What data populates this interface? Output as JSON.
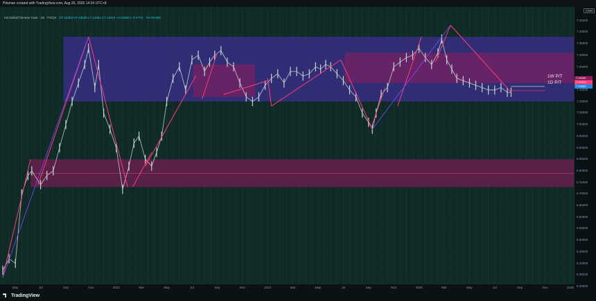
{
  "header": {
    "published_by": "Pituman created with TradingView.com, Aug 26, 2025 14:24 UTC+8"
  },
  "legend": {
    "symbol": "US Dollar/Chinese Yuan · 1D · FXCM",
    "ohlc": "O7.16383 H7.16535 L7.14361 C7.14424 −0.01959 (−0.27%)",
    "volume": "Vol 82.55K"
  },
  "price_axis": {
    "currency": "CNH",
    "last_price": "7.16040",
    "tag_2": "7.14424",
    "tag_3": "7.13550"
  },
  "annotations": {
    "weekly_pt": "1W P/T",
    "daily_pt": "1D P/T"
  },
  "footer": {
    "brand": "TradingView"
  },
  "colors": {
    "background": "#0f2a27",
    "purple_zone": "#3e2f8f",
    "pink_zone": "#8b1d5e",
    "projection": "#ff3b7a",
    "down_leg": "#7a4dff",
    "candles": "#c7d6d2"
  },
  "chart_data": {
    "type": "line",
    "title": "",
    "xlabel": "",
    "ylabel": "",
    "ylim": [
      6.3,
      7.5
    ],
    "y_ticks": [
      "7.45000",
      "7.40000",
      "7.35000",
      "7.30000",
      "7.25000",
      "7.20000",
      "7.15000",
      "7.10000",
      "7.05000",
      "7.00000",
      "6.95000",
      "6.90000",
      "6.85000",
      "6.80000",
      "6.75000",
      "6.70000",
      "6.65000",
      "6.60000",
      "6.55000",
      "6.50000",
      "6.45000",
      "6.40000",
      "6.35000",
      "6.30000"
    ],
    "x_labels": [
      "May",
      "Jul",
      "Sep",
      "Nov",
      "2023",
      "Mar",
      "May",
      "Jul",
      "Sep",
      "Nov",
      "2024",
      "Mar",
      "May",
      "Jul",
      "Sep",
      "Nov",
      "2025",
      "Mar",
      "May",
      "Jul",
      "Sep",
      "Nov",
      "2026"
    ],
    "x_label_months": [
      4.0,
      6.0,
      8.0,
      10.0,
      12.0,
      14.0,
      16.0,
      18.0,
      20.0,
      22.0,
      24.0,
      26.0,
      28.0,
      30.0,
      32.0,
      34.0,
      36.0,
      38.0,
      40.0,
      42.0,
      44.0,
      46.0,
      48.0
    ],
    "series": [
      {
        "values_x_months": [
          3.0,
          3.5,
          4.0,
          4.5,
          5.0,
          5.3,
          6.0,
          6.5,
          7.0,
          7.5,
          8.0,
          8.5,
          9.0,
          9.5,
          9.8,
          10.3,
          10.6,
          11.0,
          11.5,
          12.0,
          12.5,
          13.0,
          13.4,
          13.8,
          14.3,
          14.8,
          15.2,
          15.6,
          16.0,
          16.5,
          17.0,
          17.5,
          18.0,
          18.5,
          19.0,
          19.4,
          19.8,
          20.3,
          20.8,
          21.3,
          21.8,
          22.3,
          22.8,
          23.3,
          23.8,
          24.3,
          24.8,
          25.3,
          25.8,
          26.3,
          26.8,
          27.3,
          27.8,
          28.2,
          28.6,
          29.0,
          29.5,
          30.0,
          30.5,
          31.0,
          31.5,
          32.0,
          32.3,
          32.6,
          33.0,
          33.5,
          34.0,
          34.5,
          35.0,
          35.5,
          36.0,
          36.5,
          37.0,
          37.5,
          37.8,
          38.2,
          38.6,
          39.0,
          39.5,
          40.0,
          40.5,
          41.0,
          41.5,
          42.0,
          42.5,
          43.0,
          43.3
        ],
        "values": [
          6.37,
          6.42,
          6.4,
          6.7,
          6.78,
          6.8,
          6.74,
          6.78,
          6.8,
          6.9,
          7.0,
          7.1,
          7.18,
          7.26,
          7.33,
          7.16,
          7.26,
          7.05,
          6.98,
          6.9,
          6.72,
          6.82,
          6.92,
          6.95,
          6.85,
          6.82,
          6.88,
          6.95,
          7.1,
          7.2,
          7.25,
          7.15,
          7.28,
          7.3,
          7.23,
          7.27,
          7.3,
          7.32,
          7.27,
          7.25,
          7.18,
          7.12,
          7.1,
          7.12,
          7.17,
          7.2,
          7.22,
          7.18,
          7.23,
          7.23,
          7.21,
          7.22,
          7.25,
          7.24,
          7.26,
          7.25,
          7.22,
          7.19,
          7.15,
          7.12,
          7.05,
          7.01,
          6.98,
          7.05,
          7.13,
          7.16,
          7.25,
          7.27,
          7.29,
          7.3,
          7.33,
          7.29,
          7.26,
          7.31,
          7.37,
          7.28,
          7.24,
          7.2,
          7.19,
          7.18,
          7.17,
          7.16,
          7.15,
          7.15,
          7.16,
          7.14,
          7.14
        ]
      }
    ]
  }
}
